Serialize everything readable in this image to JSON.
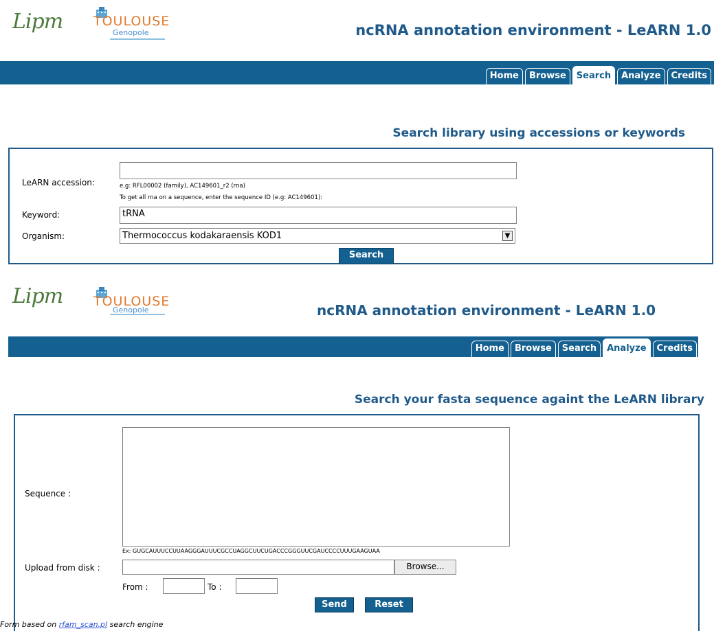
{
  "screen1": {
    "logo_lipm": "Lipm",
    "logo_toulouse": "TOULOUSE",
    "logo_genopole": "Genopole",
    "title": "ncRNA annotation environment - LeARN 1.0",
    "tabs": [
      {
        "label": "Home",
        "active": false
      },
      {
        "label": "Browse",
        "active": false
      },
      {
        "label": "Search",
        "active": true
      },
      {
        "label": "Analyze",
        "active": false
      },
      {
        "label": "Credits",
        "active": false
      }
    ],
    "section_title": "Search library using accessions or keywords",
    "form": {
      "accession_label": "LeARN accession:",
      "accession_value": "",
      "accession_hint": "e.g: RFL00002 (family), AC149601_r2 (rna)",
      "sequence_hint": "To get all rna on a sequence, enter the sequence ID (e.g: AC149601):",
      "keyword_label": "Keyword:",
      "keyword_value": "tRNA",
      "organism_label": "Organism:",
      "organism_value": "Thermococcus kodakaraensis KOD1",
      "search_button": "Search"
    }
  },
  "screen2": {
    "logo_lipm": "Lipm",
    "logo_toulouse": "TOULOUSE",
    "logo_genopole": "Genopole",
    "title": "ncRNA annotation environment - LeARN 1.0",
    "tabs": [
      {
        "label": "Home",
        "active": false
      },
      {
        "label": "Browse",
        "active": false
      },
      {
        "label": "Search",
        "active": false
      },
      {
        "label": "Analyze",
        "active": true
      },
      {
        "label": "Credits",
        "active": false
      }
    ],
    "section_title": "Search your fasta sequence againt the LeARN library",
    "form": {
      "sequence_label": "Sequence :",
      "sequence_value": "",
      "example": "Ex: GUGCAUUUCCUUAAGGGAUUUCGCCUAGGCUUCUGACCCGGGUUCGAUCCCCUUUGAAGUAA",
      "upload_label": "Upload from disk :",
      "browse_button": "Browse...",
      "from_label": "From :",
      "to_label": "To :",
      "send_button": "Send",
      "reset_button": "Reset"
    },
    "footer_prefix": "Form based on ",
    "footer_link": "rfam_scan.pl",
    "footer_suffix": " search engine"
  }
}
